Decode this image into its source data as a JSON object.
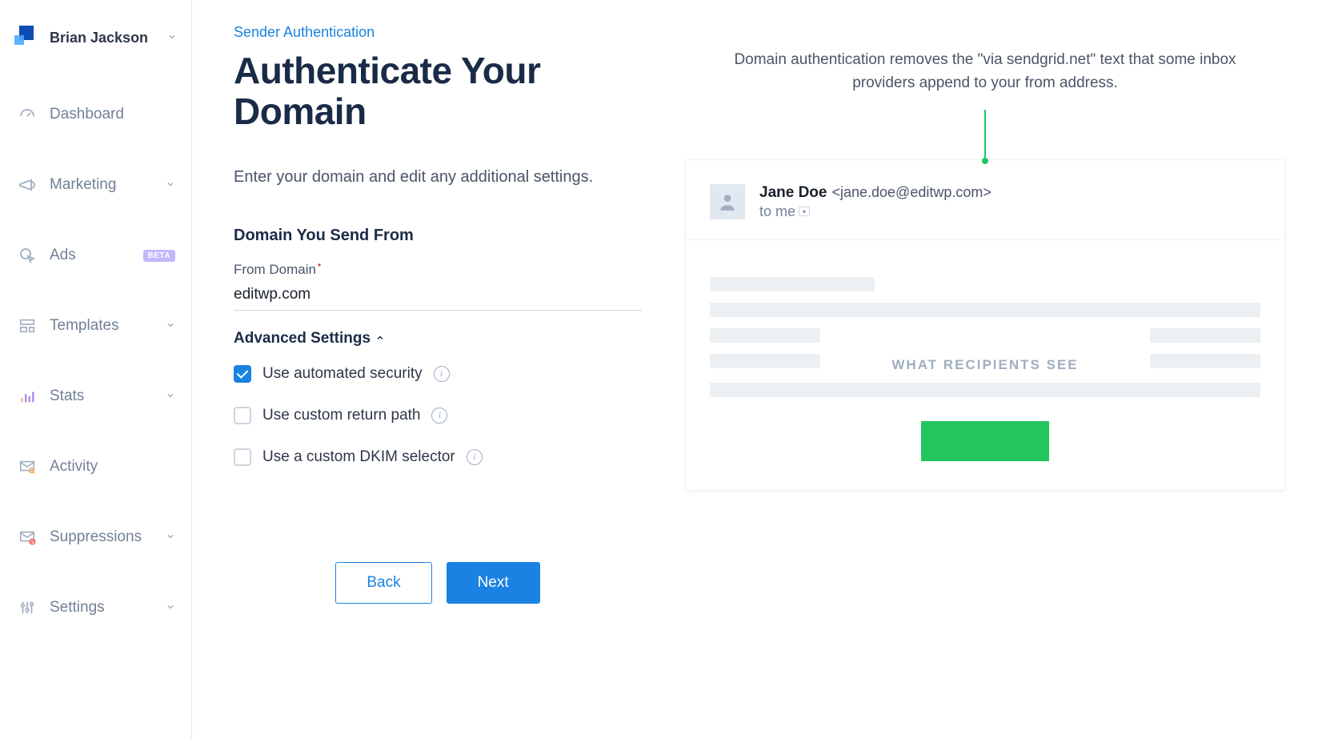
{
  "user": {
    "name": "Brian Jackson"
  },
  "sidebar": {
    "items": [
      {
        "label": "Dashboard",
        "expandable": false
      },
      {
        "label": "Marketing",
        "expandable": true
      },
      {
        "label": "Ads",
        "expandable": false,
        "badge": "BETA"
      },
      {
        "label": "Templates",
        "expandable": true
      },
      {
        "label": "Stats",
        "expandable": true
      },
      {
        "label": "Activity",
        "expandable": false
      },
      {
        "label": "Suppressions",
        "expandable": true
      },
      {
        "label": "Settings",
        "expandable": true
      }
    ]
  },
  "page": {
    "breadcrumb": "Sender Authentication",
    "title": "Authenticate Your Domain",
    "helper": "Enter your domain and edit any additional settings.",
    "section_domain_title": "Domain You Send From",
    "from_domain_label": "From Domain",
    "from_domain_value": "editwp.com",
    "advanced_title": "Advanced Settings",
    "options": [
      {
        "label": "Use automated security",
        "checked": true,
        "info": true
      },
      {
        "label": "Use custom return path",
        "checked": false,
        "info": true
      },
      {
        "label": "Use a custom DKIM selector",
        "checked": false,
        "info": true
      }
    ],
    "buttons": {
      "back": "Back",
      "next": "Next"
    }
  },
  "preview": {
    "caption": "Domain authentication removes the \"via sendgrid.net\" text that some inbox providers append to your from address.",
    "from_name": "Jane Doe",
    "from_email": "<jane.doe@editwp.com>",
    "to_line": "to me",
    "watermark": "WHAT RECIPIENTS SEE"
  }
}
